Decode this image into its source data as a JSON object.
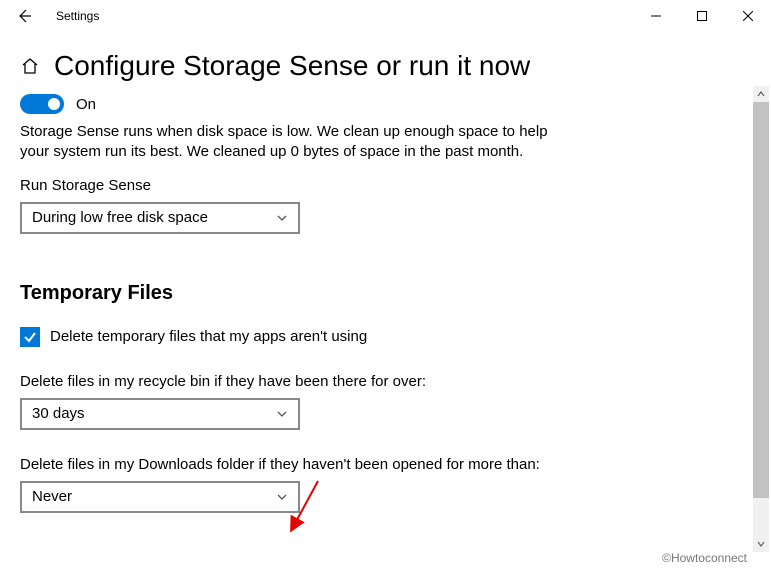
{
  "window": {
    "app_title": "Settings"
  },
  "header": {
    "page_title": "Configure Storage Sense or run it now"
  },
  "storage_sense": {
    "toggle_state": "On",
    "description": "Storage Sense runs when disk space is low. We clean up enough space to help your system run its best. We cleaned up 0 bytes of space in the past month.",
    "run_label": "Run Storage Sense",
    "run_value": "During low free disk space"
  },
  "temp_files": {
    "section_title": "Temporary Files",
    "checkbox_label": "Delete temporary files that my apps aren't using",
    "recycle_label": "Delete files in my recycle bin if they have been there for over:",
    "recycle_value": "30 days",
    "downloads_label": "Delete files in my Downloads folder if they haven't been opened for more than:",
    "downloads_value": "Never"
  },
  "watermark": "©Howtoconnect"
}
